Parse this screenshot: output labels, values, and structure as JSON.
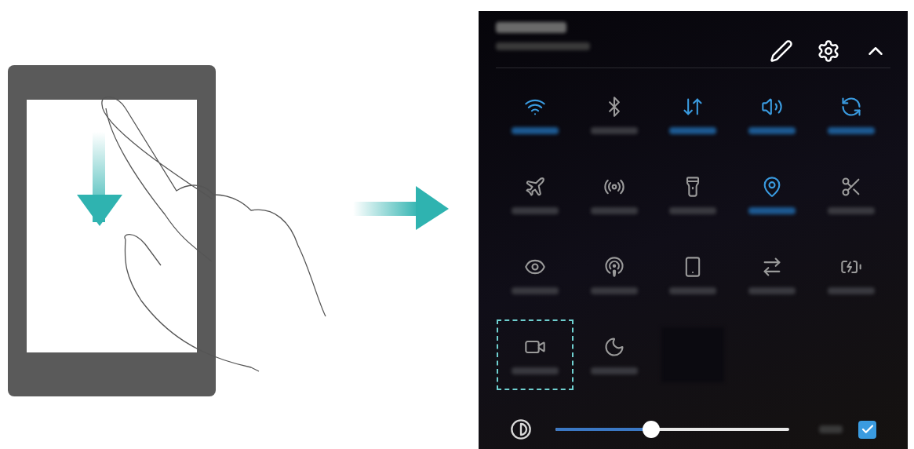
{
  "header": {
    "actions": [
      {
        "kind": "edit"
      },
      {
        "kind": "settings"
      },
      {
        "kind": "collapse"
      }
    ]
  },
  "tiles": [
    {
      "kind": "wifi",
      "on": true,
      "highlighted": false
    },
    {
      "kind": "bluetooth",
      "on": false,
      "highlighted": false
    },
    {
      "kind": "data",
      "on": true,
      "highlighted": false
    },
    {
      "kind": "sound",
      "on": true,
      "highlighted": false
    },
    {
      "kind": "rotate",
      "on": true,
      "highlighted": false
    },
    {
      "kind": "airplane",
      "on": false,
      "highlighted": false
    },
    {
      "kind": "hotspot",
      "on": false,
      "highlighted": false
    },
    {
      "kind": "flashlight",
      "on": false,
      "highlighted": false
    },
    {
      "kind": "location",
      "on": true,
      "highlighted": false
    },
    {
      "kind": "screenshot",
      "on": false,
      "highlighted": false
    },
    {
      "kind": "eye",
      "on": false,
      "highlighted": false
    },
    {
      "kind": "signal",
      "on": false,
      "highlighted": false
    },
    {
      "kind": "phone",
      "on": false,
      "highlighted": false
    },
    {
      "kind": "switch",
      "on": false,
      "highlighted": false
    },
    {
      "kind": "battery",
      "on": false,
      "highlighted": false
    },
    {
      "kind": "record",
      "on": false,
      "highlighted": true
    },
    {
      "kind": "moon",
      "on": false,
      "highlighted": false
    },
    {
      "kind": "blank"
    }
  ],
  "brightness": {
    "level": 0.41,
    "auto_checked": true
  }
}
